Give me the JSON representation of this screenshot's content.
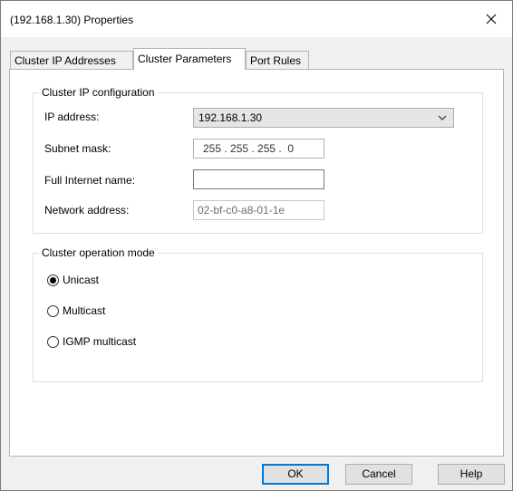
{
  "window": {
    "title": "(192.168.1.30) Properties"
  },
  "tabs": [
    {
      "label": "Cluster IP Addresses",
      "active": false
    },
    {
      "label": "Cluster Parameters",
      "active": true
    },
    {
      "label": "Port Rules",
      "active": false
    }
  ],
  "ip_config": {
    "legend": "Cluster IP configuration",
    "ip_label": "IP address:",
    "ip_value": "192.168.1.30",
    "subnet_label": "Subnet mask:",
    "subnet_value": "255 . 255 . 255 .  0",
    "fullname_label": "Full Internet name:",
    "fullname_value": "",
    "netaddr_label": "Network address:",
    "netaddr_value": "02-bf-c0-a8-01-1e"
  },
  "operation_mode": {
    "legend": "Cluster operation mode",
    "options": [
      {
        "label": "Unicast",
        "selected": true
      },
      {
        "label": "Multicast",
        "selected": false
      },
      {
        "label": "IGMP multicast",
        "selected": false
      }
    ]
  },
  "buttons": {
    "ok": "OK",
    "cancel": "Cancel",
    "help": "Help"
  }
}
